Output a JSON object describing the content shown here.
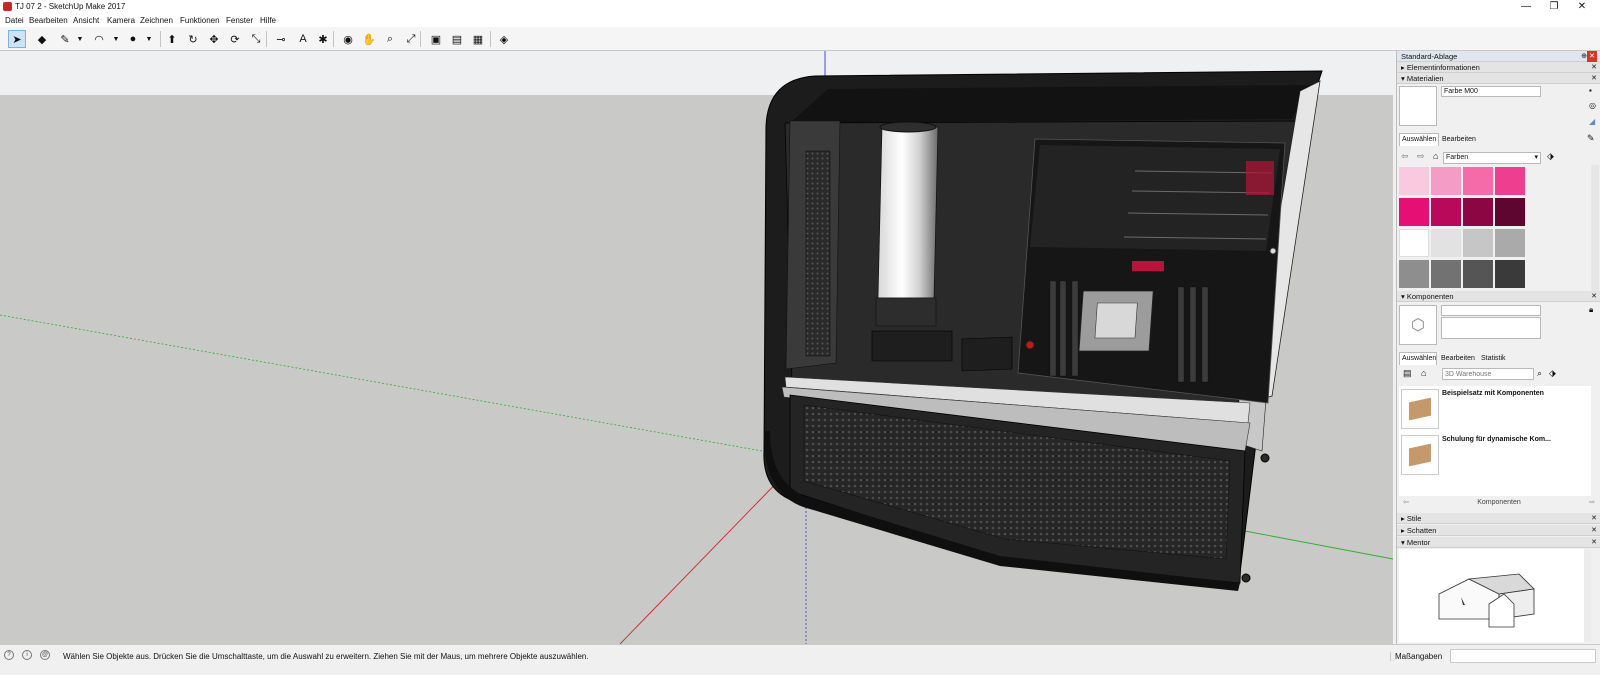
{
  "window": {
    "title": "TJ 07 2 - SketchUp Make 2017",
    "controls": [
      "—",
      "❐",
      "✕"
    ]
  },
  "menu": [
    "Datei",
    "Bearbeiten",
    "Ansicht",
    "Kamera",
    "Zeichnen",
    "Funktionen",
    "Fenster",
    "Hilfe"
  ],
  "toolbar": {
    "tools": [
      {
        "name": "select-tool-icon",
        "glyph": "➤",
        "active": true
      },
      {
        "name": "eraser-tool-icon",
        "glyph": "◆"
      },
      {
        "name": "pencil-tool-icon",
        "glyph": "✎"
      },
      {
        "name": "arc-tool-icon",
        "glyph": "◠"
      },
      {
        "name": "paint-bucket-tool-icon",
        "glyph": "●"
      },
      {
        "name": "push-pull-tool-icon",
        "glyph": "⬆"
      },
      {
        "name": "follow-me-tool-icon",
        "glyph": "↻"
      },
      {
        "name": "move-tool-icon",
        "glyph": "✥"
      },
      {
        "name": "rotate-tool-icon",
        "glyph": "⟳"
      },
      {
        "name": "scale-tool-icon",
        "glyph": "⤡"
      },
      {
        "name": "tape-measure-tool-icon",
        "glyph": "⊸"
      },
      {
        "name": "text-tool-icon",
        "glyph": "A"
      },
      {
        "name": "paint-tool-icon",
        "glyph": "✱"
      },
      {
        "name": "orbit-tool-icon",
        "glyph": "◉"
      },
      {
        "name": "pan-tool-icon",
        "glyph": "✋"
      },
      {
        "name": "zoom-tool-icon",
        "glyph": "⌕"
      },
      {
        "name": "zoom-extents-tool-icon",
        "glyph": "⤢"
      },
      {
        "name": "warehouse-tool-icon",
        "glyph": "▣"
      },
      {
        "name": "share-model-tool-icon",
        "glyph": "▤"
      },
      {
        "name": "extension-warehouse-tool-icon",
        "glyph": "▦"
      },
      {
        "name": "ruby-tool-icon",
        "glyph": "◈"
      }
    ]
  },
  "panel": {
    "tray_title": "Standard-Ablage",
    "entity_info": "Elementinformationen",
    "materials": {
      "header": "Materialien",
      "material_name": "Farbe M00",
      "tabs": [
        "Auswählen",
        "Bearbeiten"
      ],
      "library": "Farben",
      "swatches": [
        "#f9c9e0",
        "#f59cc6",
        "#f56aa9",
        "#ee3e8f",
        "#e60f73",
        "#b8095a",
        "#8a0744",
        "#5e0530",
        "#ffffff",
        "#e2e2e2",
        "#c6c6c6",
        "#aaaaaa",
        "#8e8e8e",
        "#727272",
        "#555555",
        "#3a3a3a"
      ]
    },
    "components": {
      "header": "Komponenten",
      "tabs": [
        "Auswählen",
        "Bearbeiten",
        "Statistik"
      ],
      "search_placeholder": "3D Warehouse",
      "items": [
        "Beispielsatz mit Komponenten",
        "Schulung für dynamische Kom..."
      ],
      "footer": "Komponenten"
    },
    "styles": "Stile",
    "shadows": "Schatten",
    "mentor": "Mentor"
  },
  "status": {
    "message": "Wählen Sie Objekte aus. Drücken Sie die Umschalttaste, um die Auswahl zu erweitern. Ziehen Sie mit der Maus, um mehrere Objekte auszuwählen.",
    "measurements_label": "Maßangaben",
    "circle_icons": [
      "?",
      "i",
      "@"
    ]
  },
  "colors": {
    "accent_red": "#c62828",
    "sky": "#eef0f1",
    "ground": "#c9c9c7",
    "red_axis": "#d22828",
    "green_axis": "#2fae2f",
    "blue_axis": "#3939d6"
  }
}
